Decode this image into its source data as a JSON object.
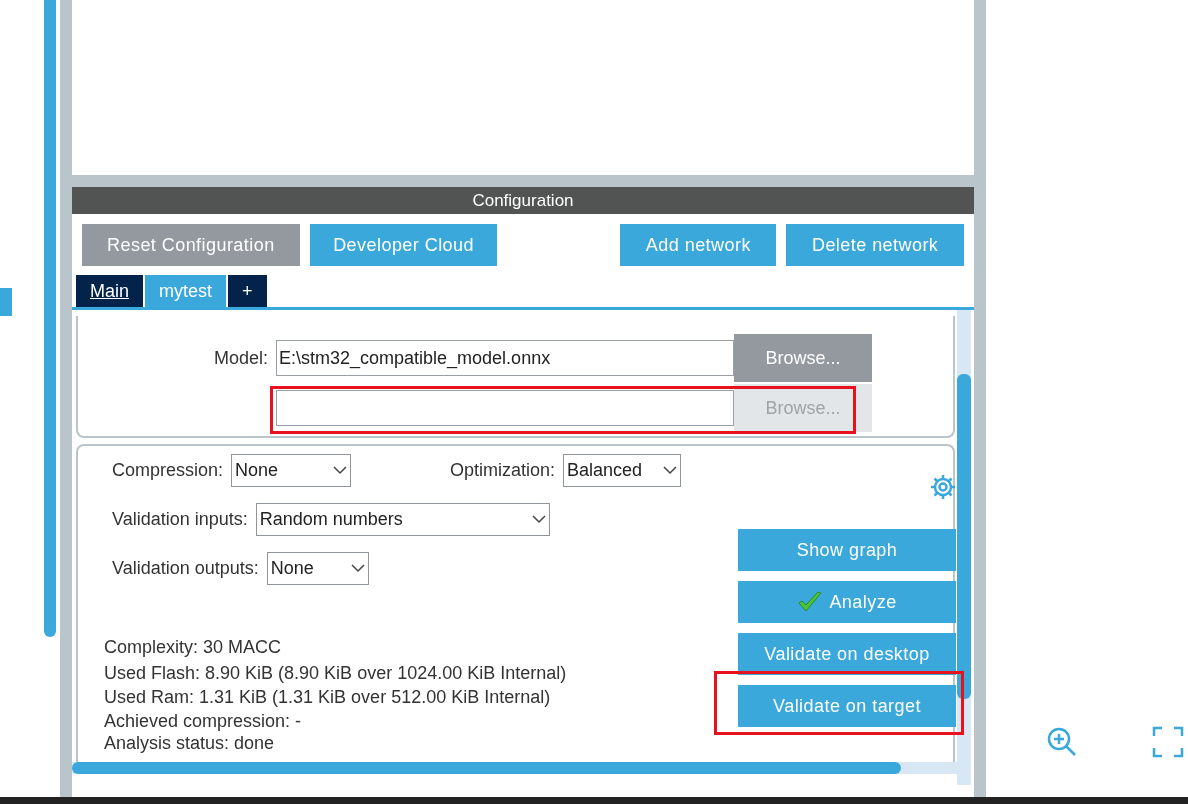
{
  "panel_title": "Configuration",
  "actions": [
    {
      "label": "Reset Configuration",
      "kind": "neutral"
    },
    {
      "label": "Developer Cloud",
      "kind": "primary"
    },
    {
      "label": "Add network",
      "kind": "primary"
    },
    {
      "label": "Delete network",
      "kind": "primary"
    }
  ],
  "tabs": [
    {
      "label": "Main",
      "selected": false
    },
    {
      "label": "mytest",
      "selected": true
    },
    {
      "label": "+",
      "selected": false
    }
  ],
  "model": {
    "label": "Model:",
    "value": "E:\\stm32_compatible_model.onnx",
    "browse": "Browse...",
    "disabled": false,
    "highlighted": false
  },
  "extra_file": {
    "browse": "Browse...",
    "disabled": true,
    "highlighted": true
  },
  "settings": [
    {
      "label": "Compression:",
      "value": "None"
    },
    {
      "label": "Optimization:",
      "value": "Balanced"
    },
    {
      "label": "Validation inputs:",
      "value": "Random numbers"
    },
    {
      "label": "Validation outputs:",
      "value": "None"
    }
  ],
  "stats": [
    "Complexity:  30 MACC",
    "Used Flash: 8.90 KiB (8.90 KiB over 1024.00 KiB Internal)",
    "Used Ram: 1.31 KiB (1.31 KiB over 512.00 KiB Internal)",
    "Achieved compression: -",
    "Analysis status: done"
  ],
  "side_buttons": [
    {
      "label": "Show graph",
      "checked": false,
      "highlighted": false
    },
    {
      "label": "Analyze",
      "checked": true,
      "highlighted": false
    },
    {
      "label": "Validate on desktop",
      "checked": false,
      "highlighted": false
    },
    {
      "label": "Validate on target",
      "checked": false,
      "highlighted": true
    }
  ]
}
